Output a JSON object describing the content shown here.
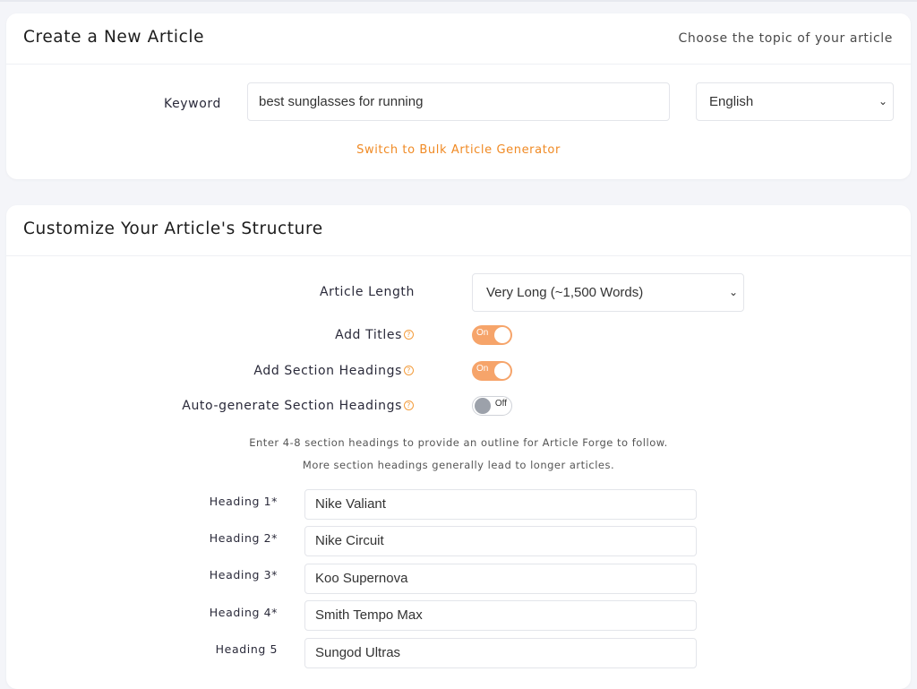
{
  "create_card": {
    "title": "Create a New Article",
    "subtitle": "Choose the topic of your article",
    "keyword_label": "Keyword",
    "keyword_value": "best sunglasses for running",
    "language_selected": "English",
    "bulk_link": "Switch to Bulk Article Generator"
  },
  "structure_card": {
    "title": "Customize Your Article's Structure",
    "article_length_label": "Article Length",
    "article_length_selected": "Very Long (~1,500 Words)",
    "add_titles_label": "Add Titles",
    "add_titles_state": "On",
    "add_section_headings_label": "Add Section Headings",
    "add_section_headings_state": "On",
    "auto_generate_label": "Auto-generate Section Headings",
    "auto_generate_state": "Off",
    "help_line_1": "Enter 4-8 section headings to provide an outline for Article Forge to follow.",
    "help_line_2": "More section headings generally lead to longer articles.",
    "headings": [
      {
        "label": "Heading 1*",
        "value": "Nike Valiant"
      },
      {
        "label": "Heading 2*",
        "value": "Nike Circuit"
      },
      {
        "label": "Heading 3*",
        "value": "Koo Supernova"
      },
      {
        "label": "Heading 4*",
        "value": "Smith Tempo Max"
      },
      {
        "label": "Heading 5",
        "value": "Sungod Ultras"
      }
    ]
  },
  "colors": {
    "accent": "#f08a24",
    "toggle_on": "#f6a46a",
    "background": "#f4f5f9"
  },
  "icons": {
    "help": "question-circle-icon",
    "dropdown": "chevron-down-icon"
  }
}
